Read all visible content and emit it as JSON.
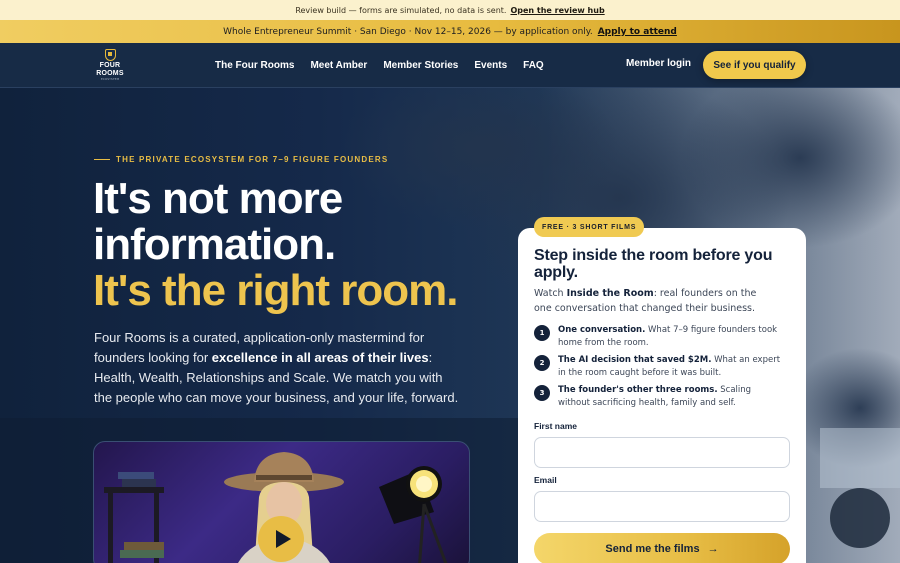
{
  "review": {
    "text": "Review build — forms are simulated, no data is sent.",
    "link": "Open the review hub"
  },
  "summit": {
    "text": "Whole Entrepreneur Summit · San Diego · Nov 12–15, 2026 — by application only.",
    "link": "Apply to attend"
  },
  "nav": {
    "logo_line1": "FOUR",
    "logo_line2": "ROOMS",
    "logo_sub": "ECOSYSTEM",
    "links": [
      "The Four Rooms",
      "Meet Amber",
      "Member Stories",
      "Events",
      "FAQ"
    ],
    "login": "Member login",
    "cta": "See if you qualify"
  },
  "hero": {
    "eyebrow": "THE PRIVATE ECOSYSTEM FOR 7–9 FIGURE FOUNDERS",
    "headline_line1": "It's not more",
    "headline_line2": "information.",
    "headline_line3": "It's the right room.",
    "lead_part1": "Four Rooms is a curated, application-only mastermind for founders looking for ",
    "lead_bold": "excellence in all areas of their lives",
    "lead_part2": ": Health, Wealth, Relationships and Scale. We match you with the people who can move your business, and your life, forward."
  },
  "card": {
    "badge": "FREE · 3 SHORT FILMS",
    "title": "Step inside the room before you apply.",
    "sub_part1": "Watch ",
    "sub_bold": "Inside the Room",
    "sub_part2": ": real founders on the one conversation that changed their business.",
    "steps": [
      {
        "num": "1",
        "title": "One conversation.",
        "text": " What 7–9 figure founders took home from the room."
      },
      {
        "num": "2",
        "title": "The AI decision that saved $2M.",
        "text": " What an expert in the room caught before it was built."
      },
      {
        "num": "3",
        "title": "The founder's other three rooms.",
        "text": " Scaling without sacrificing health, family and self."
      }
    ],
    "first_name_label": "First name",
    "first_name_value": "",
    "email_label": "Email",
    "email_value": "",
    "submit": "Send me the films",
    "submit_arrow": "→"
  },
  "colors": {
    "gold": "#eec44e",
    "navy": "#14223a"
  }
}
